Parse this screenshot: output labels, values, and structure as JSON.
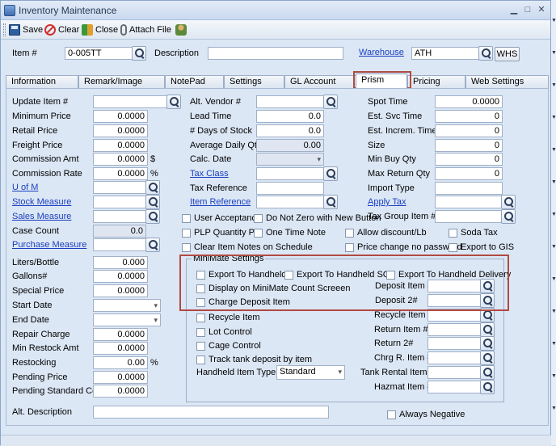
{
  "window": {
    "title": "Inventory Maintenance"
  },
  "toolbar": {
    "save": "Save",
    "clear": "Clear",
    "close": "Close",
    "attach": "Attach File"
  },
  "header": {
    "item_label": "Item #",
    "item_value": "0-005TT",
    "description_label": "Description",
    "description_value": "",
    "warehouse_label": "Warehouse",
    "warehouse_value": "ATH",
    "whs_button": "WHS"
  },
  "tabs": [
    "Information",
    "Remark/Image",
    "NotePad",
    "Settings",
    "GL Account",
    "Prism",
    "Pricing",
    "Web Settings"
  ],
  "col1": {
    "update_item": "Update Item #",
    "minimum_price": "Minimum Price",
    "minimum_price_v": "0.0000",
    "retail_price": "Retail Price",
    "retail_price_v": "0.0000",
    "freight_price": "Freight Price",
    "freight_price_v": "0.0000",
    "commission_amt": "Commission Amt",
    "commission_amt_v": "0.0000",
    "dollar": "$",
    "commission_rate": "Commission Rate",
    "commission_rate_v": "0.0000",
    "percent": "%",
    "uofm": "U of M",
    "stock_measure": "Stock Measure",
    "sales_measure": "Sales Measure",
    "case_count": "Case Count",
    "case_count_v": "0.0",
    "purchase_measure": "Purchase Measure",
    "liters": "Liters/Bottle",
    "liters_v": "0.000",
    "gallons": "Gallons#",
    "gallons_v": "0.0000",
    "special_price": "Special Price",
    "special_price_v": "0.0000",
    "start_date": "Start Date",
    "end_date": "End Date",
    "repair_charge": "Repair Charge",
    "repair_charge_v": "0.0000",
    "min_restock": "Min Restock Amt",
    "min_restock_v": "0.0000",
    "restocking": "Restocking",
    "restocking_v": "0.00",
    "restocking_pct": "%",
    "pending_price": "Pending Price",
    "pending_price_v": "0.0000",
    "pending_std_cost": "Pending Standard Cost",
    "pending_std_cost_v": "0.0000",
    "alt_description": "Alt. Description"
  },
  "col2": {
    "alt_vendor": "Alt. Vendor #",
    "lead_time": "Lead Time",
    "lead_time_v": "0.0",
    "days_stock": "# Days of Stock",
    "days_stock_v": "0.0",
    "avg_daily_qty": "Average Daily Qty",
    "avg_daily_qty_v": "0.00",
    "calc_date": "Calc. Date",
    "tax_class": "Tax Class",
    "tax_reference": "Tax Reference",
    "item_reference": "Item Reference"
  },
  "col3": {
    "spot_time": "Spot Time",
    "spot_time_v": "0.0000",
    "est_svc_time": "Est. Svc Time",
    "est_svc_time_v": "0",
    "est_increm_time": "Est. Increm. Time",
    "est_increm_time_v": "0",
    "size": "Size",
    "size_v": "0",
    "min_buy_qty": "Min Buy Qty",
    "min_buy_qty_v": "0",
    "max_return_qty": "Max Return Qty",
    "max_return_qty_v": "0",
    "import_type": "Import Type",
    "apply_tax": "Apply Tax",
    "tax_group_item": "Tax Group Item #"
  },
  "checks": {
    "user_acceptance": "User Acceptance",
    "do_not_zero": "Do Not Zero with New Button",
    "plp_qty": "PLP Quantity Prc",
    "one_time_note": "One Time Note",
    "allow_discount": "Allow discount/Lb",
    "soda_tax": "Soda Tax",
    "clear_item_notes": "Clear Item Notes on Schedule",
    "price_change": "Price change no password",
    "export_gis": "Export to GIS",
    "always_negative": "Always Negative"
  },
  "minimate": {
    "title": "MiniMate Settings",
    "export_handheld": "Export To Handheld",
    "export_handheld_sc": "Export To Handheld SC",
    "export_handheld_delivery": "Export To Handheld Delivery",
    "display_count": "Display on MiniMate Count Screeen",
    "charge_deposit": "Charge Deposit Item",
    "deposit_item": "Deposit Item #",
    "deposit2": "Deposit 2#",
    "recycle_item": "Recycle Item",
    "recycle_item_no": "Recycle Item #",
    "lot_control": "Lot Control",
    "return_item": "Return Item #",
    "cage_control": "Cage Control",
    "return2": "Return 2#",
    "track_tank": "Track tank deposit by item",
    "chrg_item": "Chrg R. Item #",
    "handheld_type": "Handheld Item Type",
    "handheld_type_v": "Standard",
    "tank_rental": "Tank Rental Item #",
    "hazmat_item": "Hazmat Item #"
  }
}
